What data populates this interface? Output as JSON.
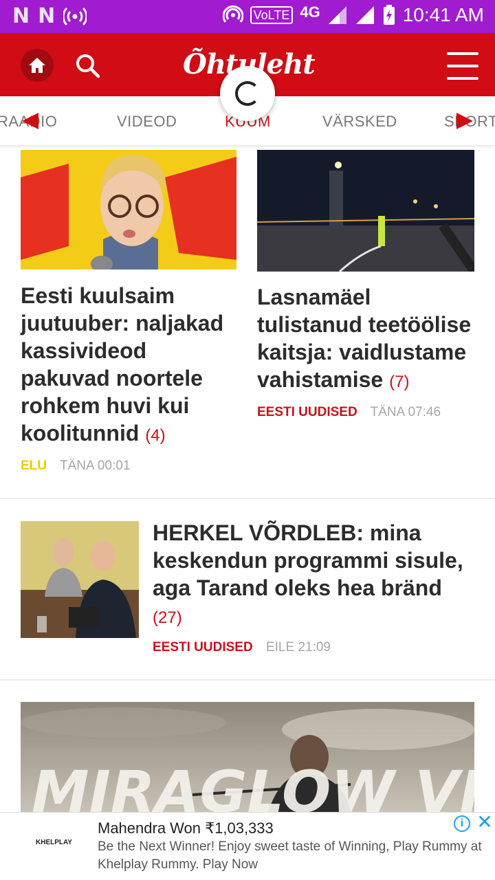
{
  "status_bar": {
    "left_icons": [
      "N",
      "N"
    ],
    "volte": "VoLTE",
    "network": "4G",
    "time": "10:41 AM"
  },
  "header": {
    "logo": "Õhtuleht",
    "home_icon": "home-icon",
    "search_icon": "search-icon",
    "menu_icon": "hamburger-menu-icon"
  },
  "tabs": [
    {
      "label": "RAADIO",
      "active": false
    },
    {
      "label": "VIDEOD",
      "active": false
    },
    {
      "label": "KUUM",
      "active": true
    },
    {
      "label": "VÄRSKED",
      "active": false
    },
    {
      "label": "SPORT",
      "active": false
    }
  ],
  "articles": [
    {
      "headline": "Eesti kuulsaim juutuuber: naljakad kassivideod pakuvad noortele rohkem huvi kui koolitunnid",
      "comments": "(4)",
      "category": "ELU",
      "category_color": "#f0c800",
      "time": "TÄNA 00:01"
    },
    {
      "headline": "Lasnamäel tulistanud teetöölise kaitsja: vaidlustame vahistamise",
      "comments": "(7)",
      "category": "EESTI UUDISED",
      "category_color": "#c8101a",
      "time": "TÄNA 07:46"
    },
    {
      "headline": "HERKEL VÕRDLEB: mina keskendun programmi sisule, aga Tarand oleks hea bränd",
      "comments": "(27)",
      "category": "EESTI UUDISED",
      "category_color": "#c8101a",
      "time": "EILE 21:09"
    },
    {
      "banner_text": "MIRAGLOW VILTU"
    }
  ],
  "ad": {
    "logo": "KHELPLAY",
    "title": "Mahendra Won ₹1,03,333",
    "text": "Be the Next Winner! Enjoy sweet taste of Winning, Play Rummy at Khelplay Rummy. Play Now",
    "info_icon": "info-icon",
    "close_icon": "close-icon"
  },
  "colors": {
    "status_bar": "#a11bd0",
    "brand_red": "#d10c14",
    "accent_red": "#c8101a"
  }
}
